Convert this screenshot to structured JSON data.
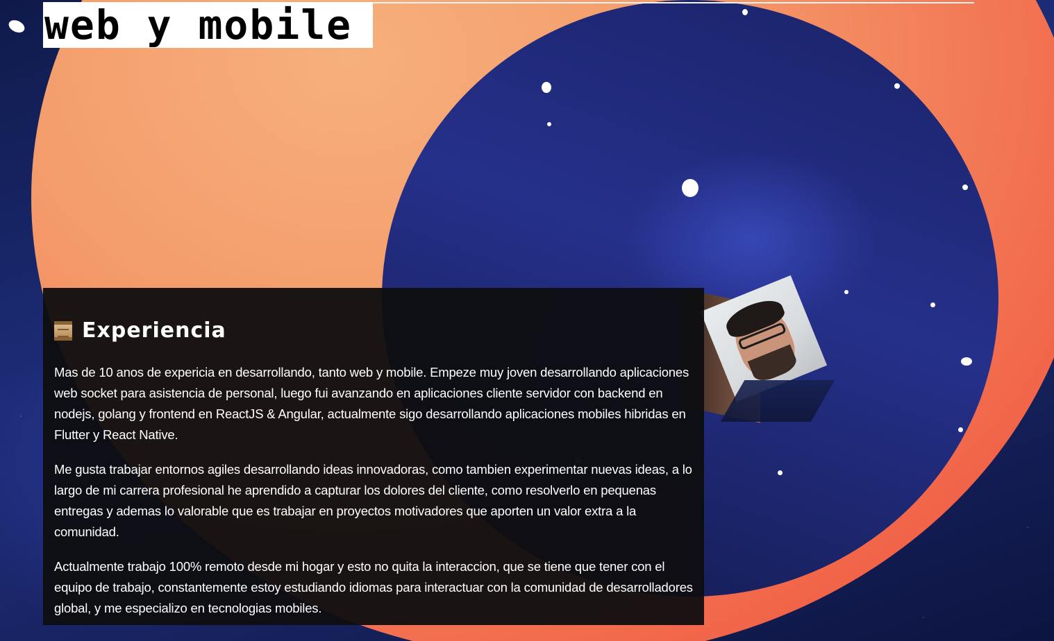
{
  "header": {
    "title": "web y mobile"
  },
  "experience": {
    "icon": "scroll-icon",
    "heading": "Experiencia",
    "paragraphs": [
      "Mas de 10 anos de expericia en desarrollando, tanto web y mobile. Empeze muy joven desarrollando aplicaciones web socket para asistencia de personal, luego fui avanzando en aplicaciones cliente servidor con backend en nodejs, golang y frontend en ReactJS & Angular, actualmente sigo desarrollando aplicaciones mobiles hibridas en Flutter y React Native.",
      "Me gusta trabajar entornos agiles desarrollando ideas innovadoras, como tambien experimentar nuevas ideas, a lo largo de mi carrera profesional he aprendido a capturar los dolores del cliente, como resolverlo en pequenas entregas y ademas lo valorable que es trabajar en proyectos motivadores que aporten un valor extra a la comunidad.",
      "Actualmente trabajo 100% remoto desde mi hogar y esto no quita la interaccion, que se tiene que tener con el equipo de trabajo, constantemente estoy estudiando idiomas para interactuar con la comunidad de desarrolladores global, y me especializo en tecnologias mobiles."
    ]
  },
  "colors": {
    "sun_outer": "#ef4a39",
    "sun_inner": "#f6b07c",
    "space": "#1d2c78",
    "panel": "#0e0e10"
  }
}
